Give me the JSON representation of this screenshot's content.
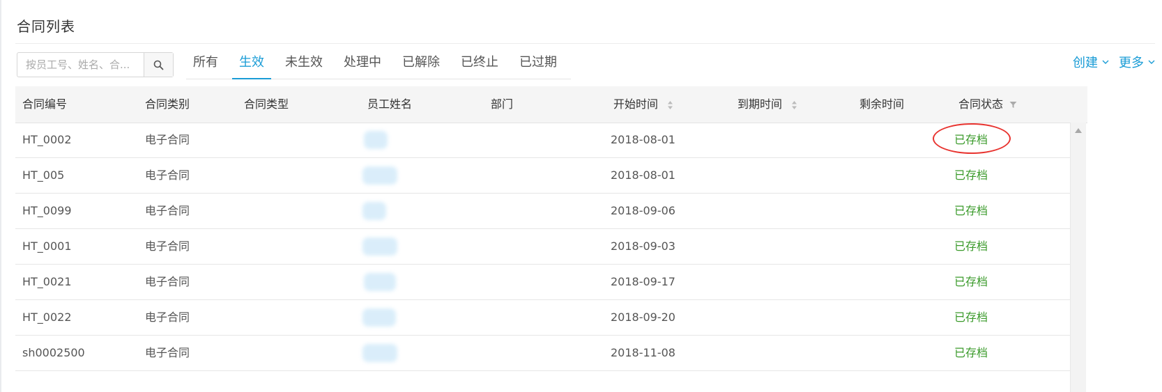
{
  "page": {
    "title": "合同列表"
  },
  "search": {
    "placeholder": "按员工号、姓名、合..."
  },
  "tabs": [
    {
      "label": "所有",
      "active": false
    },
    {
      "label": "生效",
      "active": true
    },
    {
      "label": "未生效",
      "active": false
    },
    {
      "label": "处理中",
      "active": false
    },
    {
      "label": "已解除",
      "active": false
    },
    {
      "label": "已终止",
      "active": false
    },
    {
      "label": "已过期",
      "active": false
    }
  ],
  "actions": {
    "create": "创建",
    "more": "更多"
  },
  "table": {
    "columns": {
      "contract_no": "合同编号",
      "contract_category": "合同类别",
      "contract_type": "合同类型",
      "employee_name": "员工姓名",
      "department": "部门",
      "start_time": "开始时间",
      "end_time": "到期时间",
      "remaining_time": "剩余时间",
      "contract_status": "合同状态"
    },
    "rows": [
      {
        "contract_no": "HT_0002",
        "category": "电子合同",
        "start": "2018-08-01",
        "status": "已存档"
      },
      {
        "contract_no": "HT_005",
        "category": "电子合同",
        "start": "2018-08-01",
        "status": "已存档"
      },
      {
        "contract_no": "HT_0099",
        "category": "电子合同",
        "start": "2018-09-06",
        "status": "已存档"
      },
      {
        "contract_no": "HT_0001",
        "category": "电子合同",
        "start": "2018-09-03",
        "status": "已存档"
      },
      {
        "contract_no": "HT_0021",
        "category": "电子合同",
        "start": "2018-09-17",
        "status": "已存档"
      },
      {
        "contract_no": "HT_0022",
        "category": "电子合同",
        "start": "2018-09-20",
        "status": "已存档"
      },
      {
        "contract_no": "sh0002500",
        "category": "电子合同",
        "start": "2018-11-08",
        "status": "已存档"
      }
    ]
  },
  "colors": {
    "accent": "#1a9cd6",
    "status_archived": "#3a9a2a",
    "highlight": "#e8332f"
  },
  "icons": {
    "search": "search-icon",
    "sort": "sort-icon",
    "filter": "filter-icon",
    "chevron": "chevron-down-icon"
  }
}
